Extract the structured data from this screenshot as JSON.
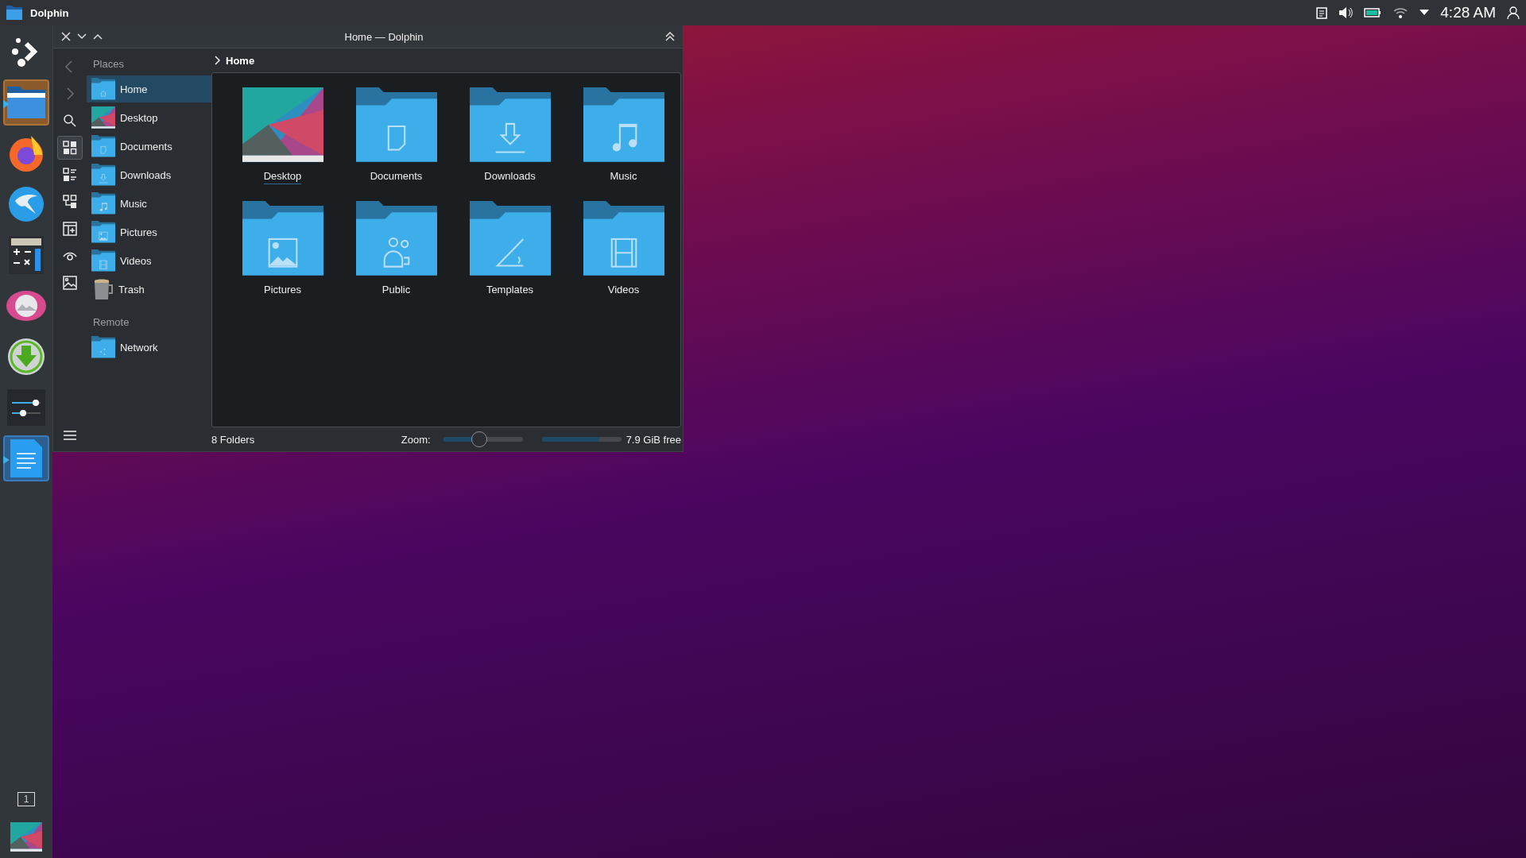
{
  "top_bar": {
    "app_name": "Dolphin",
    "clock": "4:28 AM"
  },
  "dock": {
    "items": [
      {
        "kind": "launcher",
        "attention": false,
        "selected": false
      },
      {
        "kind": "files",
        "attention": true,
        "selected": false
      },
      {
        "kind": "browser",
        "attention": false,
        "selected": false
      },
      {
        "kind": "mail",
        "attention": false,
        "selected": false
      },
      {
        "kind": "calculator",
        "attention": false,
        "selected": false
      },
      {
        "kind": "viewer",
        "attention": false,
        "selected": false
      },
      {
        "kind": "download",
        "attention": false,
        "selected": false
      },
      {
        "kind": "settings",
        "attention": false,
        "selected": false
      },
      {
        "kind": "document",
        "attention": false,
        "selected": true
      }
    ],
    "pager": "1"
  },
  "window": {
    "title": "Home — Dolphin",
    "toolbar": [
      {
        "kind": "back",
        "disabled": true,
        "selected": false
      },
      {
        "kind": "forward",
        "disabled": true,
        "selected": false
      },
      {
        "kind": "search",
        "disabled": false,
        "selected": false
      },
      {
        "kind": "icons",
        "disabled": false,
        "selected": true
      },
      {
        "kind": "details",
        "disabled": false,
        "selected": false
      },
      {
        "kind": "tree",
        "disabled": false,
        "selected": false
      },
      {
        "kind": "split",
        "disabled": false,
        "selected": false
      },
      {
        "kind": "preview",
        "disabled": false,
        "selected": false
      },
      {
        "kind": "image",
        "disabled": false,
        "selected": false
      }
    ],
    "places": {
      "heading": "Places",
      "items": [
        {
          "label": "Home",
          "kind": "home",
          "selected": true
        },
        {
          "label": "Desktop",
          "kind": "desktop",
          "selected": false
        },
        {
          "label": "Documents",
          "kind": "documents",
          "selected": false
        },
        {
          "label": "Downloads",
          "kind": "downloads",
          "selected": false
        },
        {
          "label": "Music",
          "kind": "music",
          "selected": false
        },
        {
          "label": "Pictures",
          "kind": "pictures",
          "selected": false
        },
        {
          "label": "Videos",
          "kind": "videos",
          "selected": false
        },
        {
          "label": "Trash",
          "kind": "trash",
          "selected": false
        }
      ]
    },
    "remote": {
      "heading": "Remote",
      "items": [
        {
          "label": "Network",
          "kind": "network",
          "selected": false
        }
      ]
    },
    "breadcrumb": "Home",
    "files": [
      {
        "name": "Desktop",
        "kind": "desktop",
        "focused": true
      },
      {
        "name": "Documents",
        "kind": "documents",
        "focused": false
      },
      {
        "name": "Downloads",
        "kind": "downloads",
        "focused": false
      },
      {
        "name": "Music",
        "kind": "music",
        "focused": false
      },
      {
        "name": "Pictures",
        "kind": "pictures",
        "focused": false
      },
      {
        "name": "Public",
        "kind": "public",
        "focused": false
      },
      {
        "name": "Templates",
        "kind": "templates",
        "focused": false
      },
      {
        "name": "Videos",
        "kind": "videos",
        "focused": false
      }
    ],
    "status": {
      "summary": "8 Folders",
      "zoom_label": "Zoom:",
      "zoom": {
        "level": 0.45
      },
      "space": {
        "level": 0.72
      },
      "free": "7.9 GiB free"
    }
  }
}
